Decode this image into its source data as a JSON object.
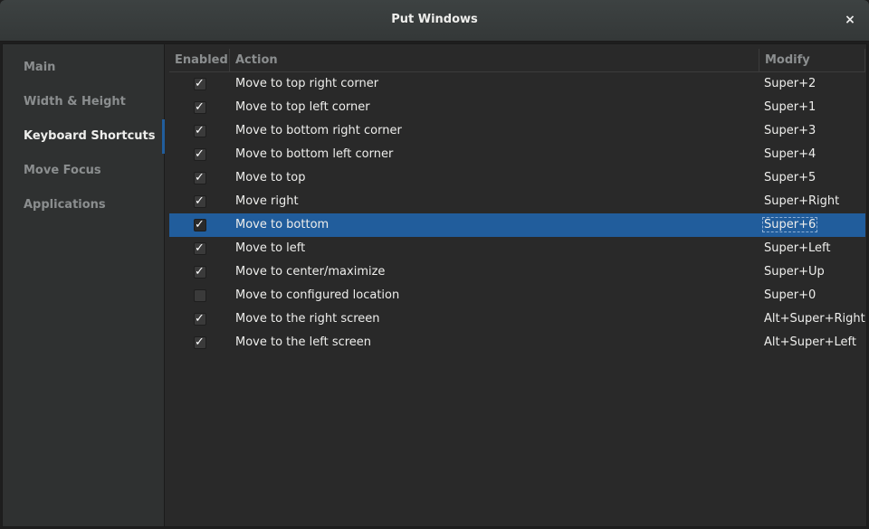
{
  "window": {
    "title": "Put Windows",
    "close_icon": "×"
  },
  "sidebar": {
    "items": [
      {
        "label": "Main",
        "active": false
      },
      {
        "label": "Width & Height",
        "active": false
      },
      {
        "label": "Keyboard Shortcuts",
        "active": true
      },
      {
        "label": "Move Focus",
        "active": false
      },
      {
        "label": "Applications",
        "active": false
      }
    ]
  },
  "colors": {
    "selection": "#215d9c",
    "background": "#292929"
  },
  "table": {
    "headers": [
      "Enabled",
      "Action",
      "Modify"
    ],
    "selected_index": 6,
    "rows": [
      {
        "enabled": true,
        "action": "Move to top right corner",
        "modify": "Super+2"
      },
      {
        "enabled": true,
        "action": "Move to top left corner",
        "modify": "Super+1"
      },
      {
        "enabled": true,
        "action": "Move to bottom right corner",
        "modify": "Super+3"
      },
      {
        "enabled": true,
        "action": "Move to bottom left corner",
        "modify": "Super+4"
      },
      {
        "enabled": true,
        "action": "Move to top",
        "modify": "Super+5"
      },
      {
        "enabled": true,
        "action": "Move right",
        "modify": "Super+Right"
      },
      {
        "enabled": true,
        "action": "Move to bottom",
        "modify": "Super+6"
      },
      {
        "enabled": true,
        "action": "Move to left",
        "modify": "Super+Left"
      },
      {
        "enabled": true,
        "action": "Move to center/maximize",
        "modify": "Super+Up"
      },
      {
        "enabled": false,
        "action": "Move to configured location",
        "modify": "Super+0"
      },
      {
        "enabled": true,
        "action": "Move to the right screen",
        "modify": "Alt+Super+Right"
      },
      {
        "enabled": true,
        "action": "Move to the left screen",
        "modify": "Alt+Super+Left"
      }
    ]
  }
}
